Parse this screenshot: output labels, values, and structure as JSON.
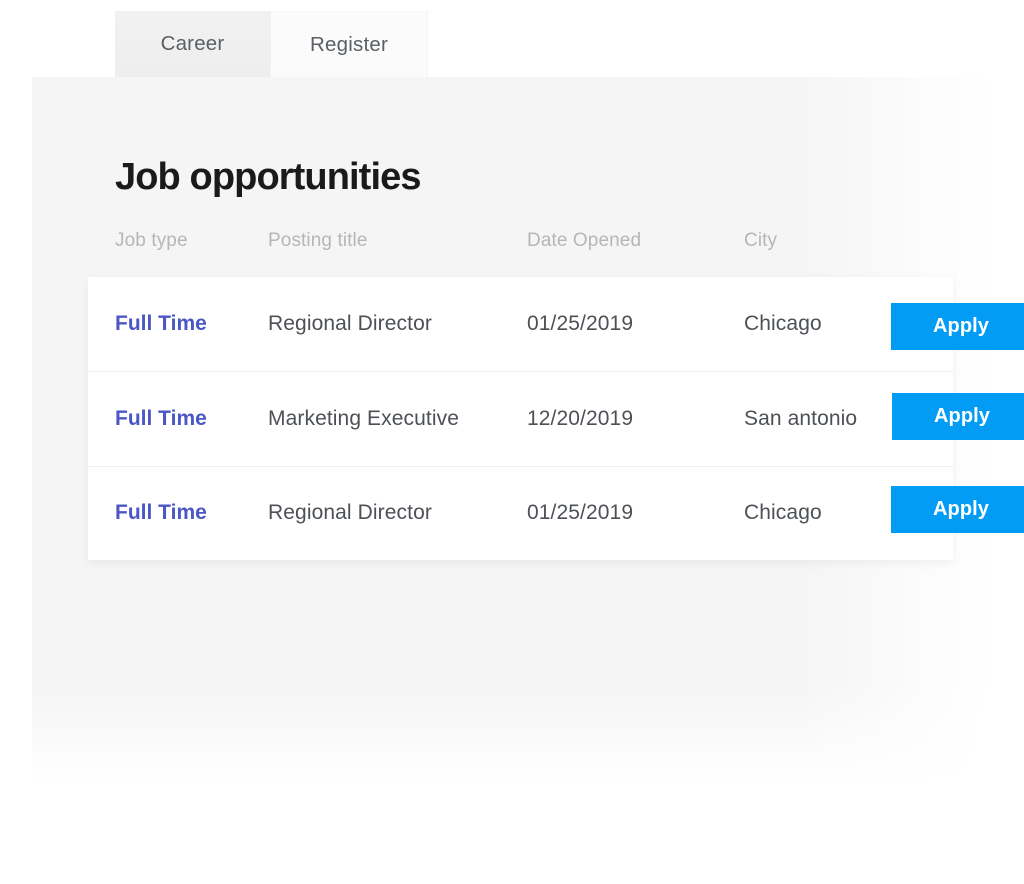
{
  "tabs": [
    {
      "label": "Career",
      "state": "active"
    },
    {
      "label": "Register",
      "state": "inactive"
    }
  ],
  "page": {
    "title": "Job opportunities"
  },
  "table": {
    "headers": [
      {
        "key": "job_type",
        "label": "Job type"
      },
      {
        "key": "posting_title",
        "label": "Posting title"
      },
      {
        "key": "date_opened",
        "label": "Date Opened"
      },
      {
        "key": "city",
        "label": "City"
      }
    ],
    "rows": [
      {
        "job_type": "Full Time",
        "posting_title": "Regional Director",
        "date_opened": "01/25/2019",
        "city": "Chicago",
        "action_label": "Apply"
      },
      {
        "job_type": "Full Time",
        "posting_title": "Marketing Executive",
        "date_opened": "12/20/2019",
        "city": "San antonio",
        "action_label": "Apply"
      },
      {
        "job_type": "Full Time",
        "posting_title": "Regional Director",
        "date_opened": "01/25/2019",
        "city": "Chicago",
        "action_label": "Apply"
      }
    ]
  },
  "colors": {
    "accent_button": "#029cf5",
    "job_type_link": "#4a57c4",
    "panel_background": "#f5f5f5",
    "header_text": "#b4b7ba",
    "body_text": "#4d5156",
    "title_text": "#1a1a1a",
    "active_tab_background": "#f0f0f0"
  }
}
